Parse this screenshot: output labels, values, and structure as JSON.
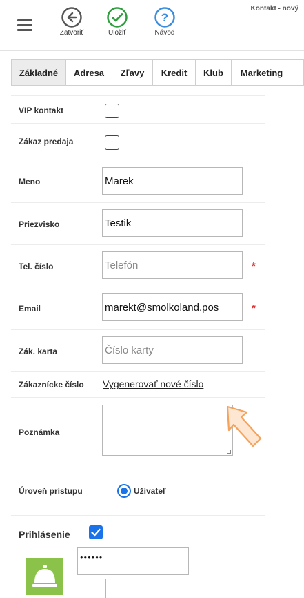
{
  "window": {
    "title": "Kontakt - nový"
  },
  "toolbar": {
    "close_label": "Zatvoriť",
    "save_label": "Uložiť",
    "help_label": "Návod",
    "close_color": "#555555",
    "save_color": "#2e9e3f",
    "help_color": "#3a8ee0"
  },
  "tabs": [
    {
      "label": "Základné",
      "active": true
    },
    {
      "label": "Adresa",
      "active": false
    },
    {
      "label": "Zľavy",
      "active": false
    },
    {
      "label": "Kredit",
      "active": false
    },
    {
      "label": "Klub",
      "active": false
    },
    {
      "label": "Marketing",
      "active": false
    }
  ],
  "form": {
    "vip": {
      "label": "VIP kontakt",
      "checked": false
    },
    "ban": {
      "label": "Zákaz predaja",
      "checked": false
    },
    "first_name": {
      "label": "Meno",
      "value": "Marek"
    },
    "last_name": {
      "label": "Priezvisko",
      "value": "Testik"
    },
    "phone": {
      "label": "Tel. číslo",
      "placeholder": "Telefón",
      "required_mark": "*"
    },
    "email": {
      "label": "Email",
      "value": "marekt@smolkoland.pos",
      "required_mark": "*"
    },
    "card": {
      "label": "Zák. karta",
      "placeholder": "Číslo karty"
    },
    "customer_number": {
      "label": "Zákaznícke číslo",
      "link": "Vygenerovať nové číslo"
    },
    "note": {
      "label": "Poznámka",
      "value": ""
    },
    "access_level": {
      "label": "Úroveň prístupu",
      "option": "Užívateľ",
      "selected": true
    },
    "login": {
      "label": "Prihlásenie",
      "checked": true,
      "password_mask": "••••••"
    }
  },
  "colors": {
    "accent": "#1a73e8",
    "required": "#e23333",
    "bell_tile": "#8bc34a",
    "arrow": "#f6a25a"
  }
}
